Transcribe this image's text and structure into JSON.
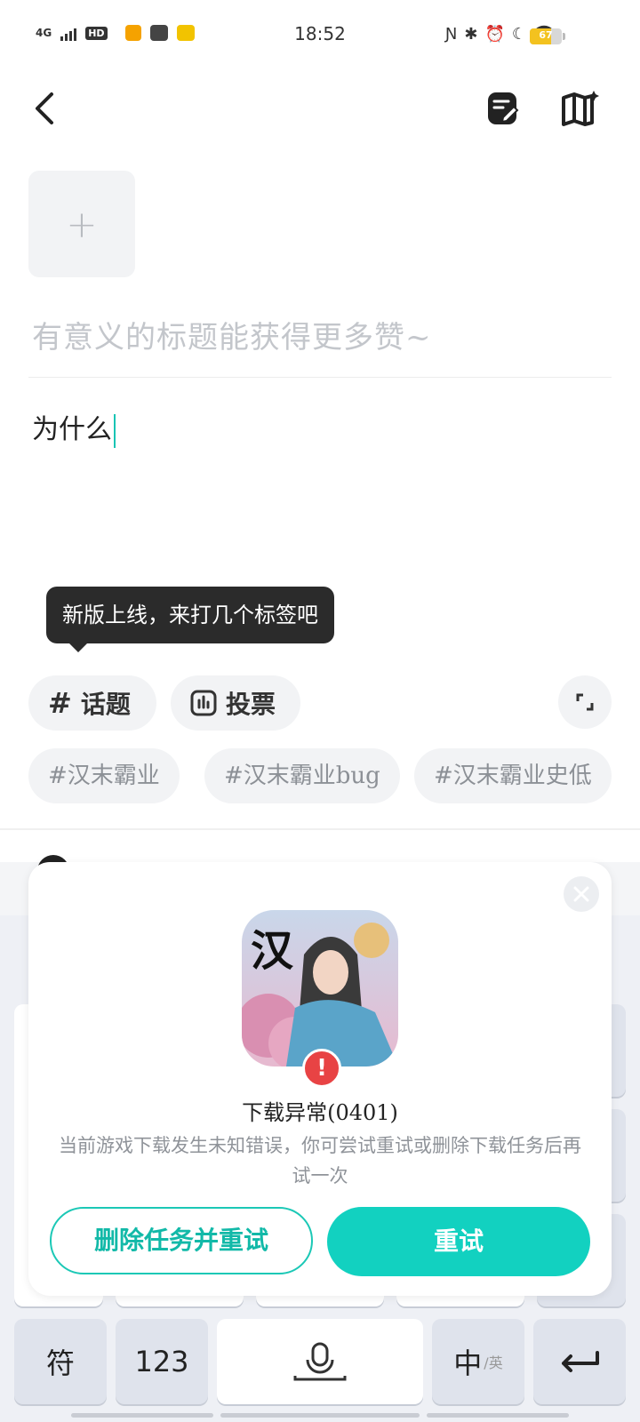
{
  "status_bar": {
    "network": "4G",
    "hd": "HD",
    "time": "18:52",
    "battery": "67",
    "battery_level": 0.67,
    "icons": [
      "nfc-icon",
      "bluetooth-icon",
      "alarm-icon",
      "moon-icon",
      "wifi-icon"
    ]
  },
  "editor": {
    "title_placeholder": "有意义的标题能获得更多赞~",
    "body_text": "为什么",
    "tooltip": "新版上线，来打几个标签吧"
  },
  "tools": {
    "topic": "话题",
    "vote": "投票"
  },
  "tags": [
    "#汉末霸业",
    "#汉末霸业bug",
    "#汉末霸业史低"
  ],
  "dialog": {
    "title": "下载异常(0401)",
    "message": "当前游戏下载发生未知错误，你可尝试重试或删除下载任务后再试一次",
    "delete_button": "删除任务并重试",
    "retry_button": "重试",
    "game_icon_char": "汉"
  },
  "keyboard": {
    "symbol_key": "符",
    "number_key": "123",
    "lang_key": "中",
    "lang_key_sub": "/英"
  }
}
